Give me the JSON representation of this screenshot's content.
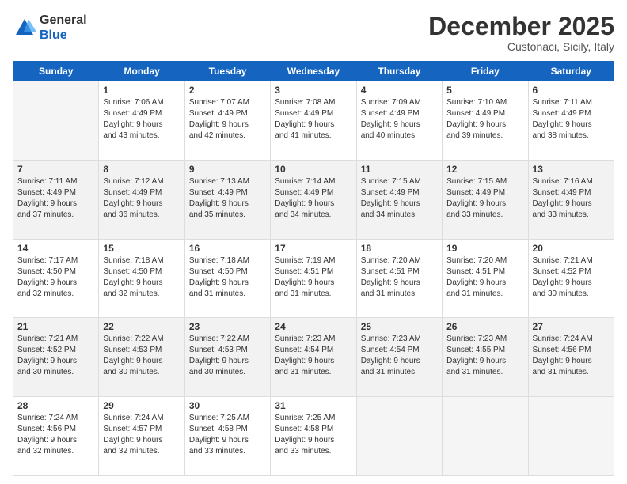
{
  "logo": {
    "general": "General",
    "blue": "Blue"
  },
  "header": {
    "month": "December 2025",
    "location": "Custonaci, Sicily, Italy"
  },
  "weekdays": [
    "Sunday",
    "Monday",
    "Tuesday",
    "Wednesday",
    "Thursday",
    "Friday",
    "Saturday"
  ],
  "weeks": [
    [
      {
        "day": "",
        "info": ""
      },
      {
        "day": "1",
        "info": "Sunrise: 7:06 AM\nSunset: 4:49 PM\nDaylight: 9 hours\nand 43 minutes."
      },
      {
        "day": "2",
        "info": "Sunrise: 7:07 AM\nSunset: 4:49 PM\nDaylight: 9 hours\nand 42 minutes."
      },
      {
        "day": "3",
        "info": "Sunrise: 7:08 AM\nSunset: 4:49 PM\nDaylight: 9 hours\nand 41 minutes."
      },
      {
        "day": "4",
        "info": "Sunrise: 7:09 AM\nSunset: 4:49 PM\nDaylight: 9 hours\nand 40 minutes."
      },
      {
        "day": "5",
        "info": "Sunrise: 7:10 AM\nSunset: 4:49 PM\nDaylight: 9 hours\nand 39 minutes."
      },
      {
        "day": "6",
        "info": "Sunrise: 7:11 AM\nSunset: 4:49 PM\nDaylight: 9 hours\nand 38 minutes."
      }
    ],
    [
      {
        "day": "7",
        "info": "Sunrise: 7:11 AM\nSunset: 4:49 PM\nDaylight: 9 hours\nand 37 minutes."
      },
      {
        "day": "8",
        "info": "Sunrise: 7:12 AM\nSunset: 4:49 PM\nDaylight: 9 hours\nand 36 minutes."
      },
      {
        "day": "9",
        "info": "Sunrise: 7:13 AM\nSunset: 4:49 PM\nDaylight: 9 hours\nand 35 minutes."
      },
      {
        "day": "10",
        "info": "Sunrise: 7:14 AM\nSunset: 4:49 PM\nDaylight: 9 hours\nand 34 minutes."
      },
      {
        "day": "11",
        "info": "Sunrise: 7:15 AM\nSunset: 4:49 PM\nDaylight: 9 hours\nand 34 minutes."
      },
      {
        "day": "12",
        "info": "Sunrise: 7:15 AM\nSunset: 4:49 PM\nDaylight: 9 hours\nand 33 minutes."
      },
      {
        "day": "13",
        "info": "Sunrise: 7:16 AM\nSunset: 4:49 PM\nDaylight: 9 hours\nand 33 minutes."
      }
    ],
    [
      {
        "day": "14",
        "info": "Sunrise: 7:17 AM\nSunset: 4:50 PM\nDaylight: 9 hours\nand 32 minutes."
      },
      {
        "day": "15",
        "info": "Sunrise: 7:18 AM\nSunset: 4:50 PM\nDaylight: 9 hours\nand 32 minutes."
      },
      {
        "day": "16",
        "info": "Sunrise: 7:18 AM\nSunset: 4:50 PM\nDaylight: 9 hours\nand 31 minutes."
      },
      {
        "day": "17",
        "info": "Sunrise: 7:19 AM\nSunset: 4:51 PM\nDaylight: 9 hours\nand 31 minutes."
      },
      {
        "day": "18",
        "info": "Sunrise: 7:20 AM\nSunset: 4:51 PM\nDaylight: 9 hours\nand 31 minutes."
      },
      {
        "day": "19",
        "info": "Sunrise: 7:20 AM\nSunset: 4:51 PM\nDaylight: 9 hours\nand 31 minutes."
      },
      {
        "day": "20",
        "info": "Sunrise: 7:21 AM\nSunset: 4:52 PM\nDaylight: 9 hours\nand 30 minutes."
      }
    ],
    [
      {
        "day": "21",
        "info": "Sunrise: 7:21 AM\nSunset: 4:52 PM\nDaylight: 9 hours\nand 30 minutes."
      },
      {
        "day": "22",
        "info": "Sunrise: 7:22 AM\nSunset: 4:53 PM\nDaylight: 9 hours\nand 30 minutes."
      },
      {
        "day": "23",
        "info": "Sunrise: 7:22 AM\nSunset: 4:53 PM\nDaylight: 9 hours\nand 30 minutes."
      },
      {
        "day": "24",
        "info": "Sunrise: 7:23 AM\nSunset: 4:54 PM\nDaylight: 9 hours\nand 31 minutes."
      },
      {
        "day": "25",
        "info": "Sunrise: 7:23 AM\nSunset: 4:54 PM\nDaylight: 9 hours\nand 31 minutes."
      },
      {
        "day": "26",
        "info": "Sunrise: 7:23 AM\nSunset: 4:55 PM\nDaylight: 9 hours\nand 31 minutes."
      },
      {
        "day": "27",
        "info": "Sunrise: 7:24 AM\nSunset: 4:56 PM\nDaylight: 9 hours\nand 31 minutes."
      }
    ],
    [
      {
        "day": "28",
        "info": "Sunrise: 7:24 AM\nSunset: 4:56 PM\nDaylight: 9 hours\nand 32 minutes."
      },
      {
        "day": "29",
        "info": "Sunrise: 7:24 AM\nSunset: 4:57 PM\nDaylight: 9 hours\nand 32 minutes."
      },
      {
        "day": "30",
        "info": "Sunrise: 7:25 AM\nSunset: 4:58 PM\nDaylight: 9 hours\nand 33 minutes."
      },
      {
        "day": "31",
        "info": "Sunrise: 7:25 AM\nSunset: 4:58 PM\nDaylight: 9 hours\nand 33 minutes."
      },
      {
        "day": "",
        "info": ""
      },
      {
        "day": "",
        "info": ""
      },
      {
        "day": "",
        "info": ""
      }
    ]
  ]
}
